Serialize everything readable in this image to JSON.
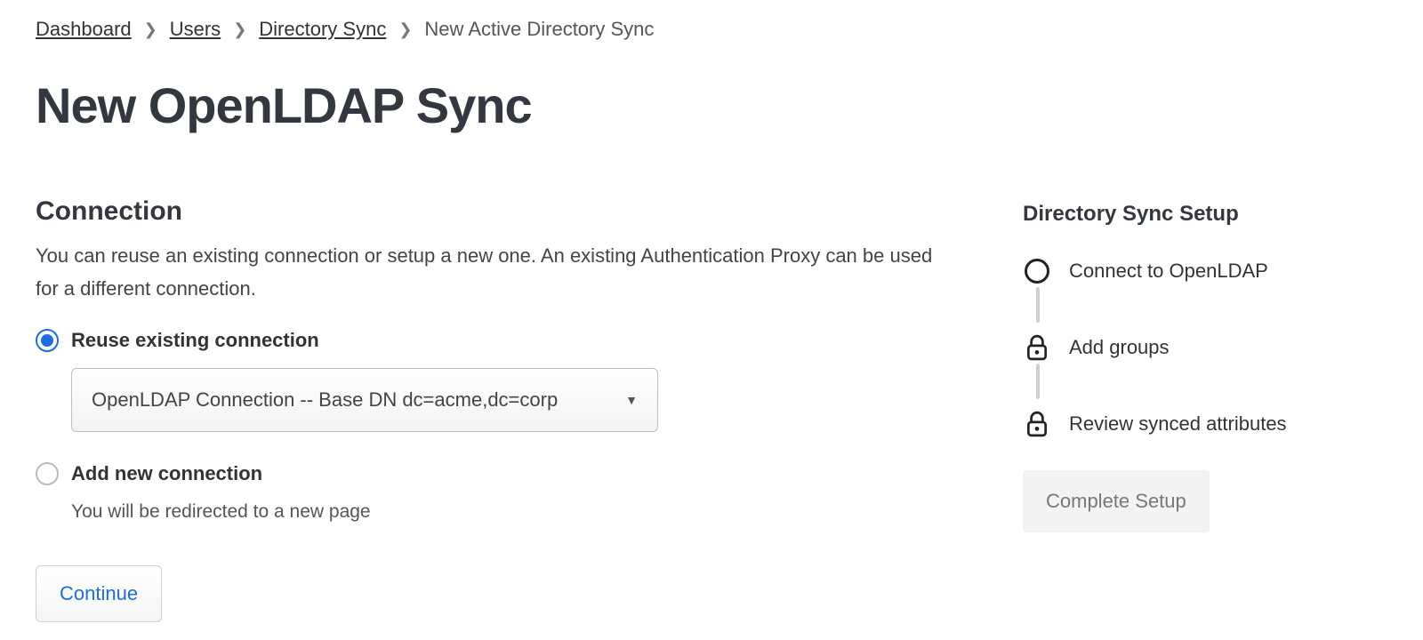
{
  "breadcrumb": {
    "items": [
      "Dashboard",
      "Users",
      "Directory Sync"
    ],
    "current": "New Active Directory Sync"
  },
  "page": {
    "title": "New OpenLDAP Sync"
  },
  "connection": {
    "heading": "Connection",
    "description": "You can reuse an existing connection or setup a new one. An existing Authentication Proxy can be used for a different connection.",
    "reuse_label": "Reuse existing connection",
    "dropdown_selected": "OpenLDAP Connection -- Base DN dc=acme,dc=corp",
    "addnew_label": "Add new connection",
    "addnew_note": "You will be redirected to a new page",
    "continue_label": "Continue"
  },
  "sidebar": {
    "title": "Directory Sync Setup",
    "steps": [
      {
        "label": "Connect to OpenLDAP",
        "icon": "circle"
      },
      {
        "label": "Add groups",
        "icon": "lock"
      },
      {
        "label": "Review synced attributes",
        "icon": "lock"
      }
    ],
    "complete_label": "Complete Setup"
  }
}
